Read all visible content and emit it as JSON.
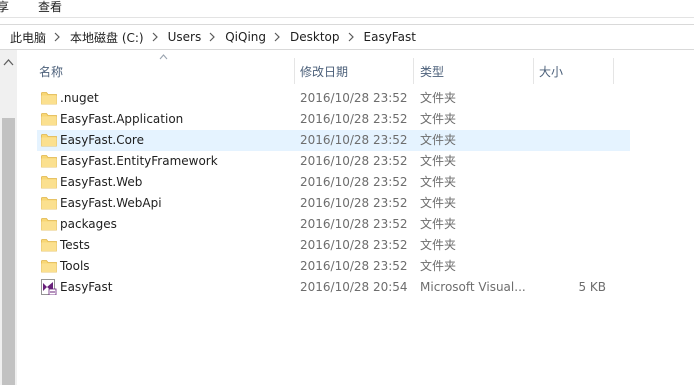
{
  "ribbon": {
    "tabs": [
      {
        "label": "享"
      },
      {
        "label": "查看"
      }
    ]
  },
  "address": {
    "crumbs": [
      {
        "label": "此电脑"
      },
      {
        "label": "本地磁盘 (C:)"
      },
      {
        "label": "Users"
      },
      {
        "label": "QiQing"
      },
      {
        "label": "Desktop"
      },
      {
        "label": "EasyFast"
      }
    ]
  },
  "columns": {
    "name": "名称",
    "date": "修改日期",
    "type": "类型",
    "size": "大小"
  },
  "files": [
    {
      "name": ".nuget",
      "date": "2016/10/28 23:52",
      "type": "文件夹",
      "size": "",
      "icon": "folder-icon",
      "selected": false
    },
    {
      "name": "EasyFast.Application",
      "date": "2016/10/28 23:52",
      "type": "文件夹",
      "size": "",
      "icon": "folder-icon",
      "selected": false
    },
    {
      "name": "EasyFast.Core",
      "date": "2016/10/28 23:52",
      "type": "文件夹",
      "size": "",
      "icon": "folder-icon",
      "selected": true
    },
    {
      "name": "EasyFast.EntityFramework",
      "date": "2016/10/28 23:52",
      "type": "文件夹",
      "size": "",
      "icon": "folder-icon",
      "selected": false
    },
    {
      "name": "EasyFast.Web",
      "date": "2016/10/28 23:52",
      "type": "文件夹",
      "size": "",
      "icon": "folder-icon",
      "selected": false
    },
    {
      "name": "EasyFast.WebApi",
      "date": "2016/10/28 23:52",
      "type": "文件夹",
      "size": "",
      "icon": "folder-icon",
      "selected": false
    },
    {
      "name": "packages",
      "date": "2016/10/28 23:52",
      "type": "文件夹",
      "size": "",
      "icon": "folder-icon",
      "selected": false
    },
    {
      "name": "Tests",
      "date": "2016/10/28 23:52",
      "type": "文件夹",
      "size": "",
      "icon": "folder-icon",
      "selected": false
    },
    {
      "name": "Tools",
      "date": "2016/10/28 23:52",
      "type": "文件夹",
      "size": "",
      "icon": "folder-icon",
      "selected": false
    },
    {
      "name": "EasyFast",
      "date": "2016/10/28 20:54",
      "type": "Microsoft Visual...",
      "size": "5 KB",
      "icon": "visual-studio-solution-icon",
      "selected": false
    }
  ],
  "colors": {
    "selection": "#e5f3ff",
    "header_text": "#4c607a",
    "folder": "#f5d36f"
  }
}
